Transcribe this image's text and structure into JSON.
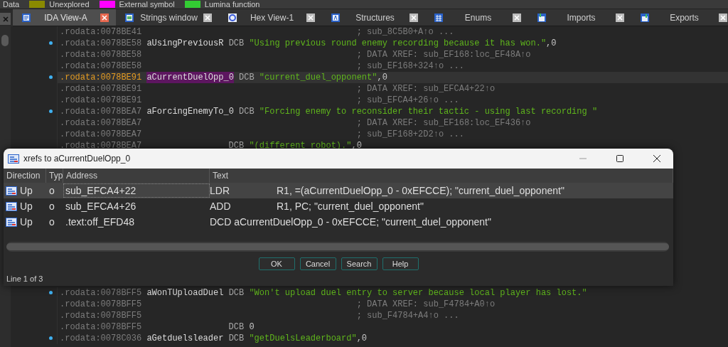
{
  "legend": [
    {
      "label": "Data"
    },
    {
      "label": "Unexplored",
      "color": "#8a8a00"
    },
    {
      "label": "External symbol",
      "color": "#ff00ff"
    },
    {
      "label": "Lumina function",
      "color": "#33cc33"
    }
  ],
  "tabs": [
    {
      "label": "IDA View-A",
      "kind": "disassembly",
      "selected": true
    },
    {
      "label": "Strings window",
      "kind": "strings",
      "selected": false
    },
    {
      "label": "Hex View-1",
      "kind": "hex",
      "selected": false
    },
    {
      "label": "Structures",
      "kind": "structures",
      "selected": false
    },
    {
      "label": "Enums",
      "kind": "enums",
      "selected": false
    },
    {
      "label": "Imports",
      "kind": "imports",
      "selected": false
    },
    {
      "label": "Exports",
      "kind": "exports",
      "selected": false
    }
  ],
  "listing": {
    "lines": [
      {
        "address": ".rodata:0078BE41",
        "comment": "; sub_8C5B0+A↑o ...",
        "marker": false,
        "current": false
      },
      {
        "address": ".rodata:0078BE58",
        "label": "aUsingPreviousR",
        "mnemonic": "DCB",
        "string": "\"Using previous round enemy recording because it has won.\"",
        "tail": ",0",
        "marker": true,
        "current": false
      },
      {
        "address": ".rodata:0078BE58",
        "comment": "; DATA XREF: sub_EF168:loc_EF48A↑o",
        "marker": false,
        "current": false
      },
      {
        "address": ".rodata:0078BE58",
        "comment": "; sub_EF168+324↑o ...",
        "marker": false,
        "current": false
      },
      {
        "address": ".rodata:0078BE91",
        "label": "aCurrentDuelOpp_0",
        "mnemonic": "DCB",
        "string": "\"current_duel_opponent\"",
        "tail": ",0",
        "marker": true,
        "current": true
      },
      {
        "address": ".rodata:0078BE91",
        "comment": "; DATA XREF: sub_EFCA4+22↑o",
        "marker": false,
        "current": false
      },
      {
        "address": ".rodata:0078BE91",
        "comment": "; sub_EFCA4+26↑o ...",
        "marker": false,
        "current": false
      },
      {
        "address": ".rodata:0078BEA7",
        "label": "aForcingEnemyTo_0",
        "mnemonic": "DCB",
        "string": "\"Forcing enemy to reconsider their tactic - using last recording \"",
        "marker": true,
        "current": false
      },
      {
        "address": ".rodata:0078BEA7",
        "comment": "; DATA XREF: sub_EF168:loc_EF436↑o",
        "marker": false,
        "current": false
      },
      {
        "address": ".rodata:0078BEA7",
        "comment": "; sub_EF168+2D2↑o ...",
        "marker": false,
        "current": false
      },
      {
        "address": ".rodata:0078BEA7",
        "mnemonic": "DCB",
        "string": "\"(different robot).\"",
        "tail": ",0",
        "marker": false,
        "current": false
      }
    ],
    "lines_below": [
      {
        "address": ".rodata:0078BFF5",
        "label": "aWonTUploadDuel",
        "mnemonic": "DCB",
        "string": "\"Won't upload duel entry to server because local player has lost.\"",
        "marker": true,
        "current": false
      },
      {
        "address": ".rodata:0078BFF5",
        "comment": "; DATA XREF: sub_F4784+A0↑o",
        "marker": false,
        "current": false
      },
      {
        "address": ".rodata:0078BFF5",
        "comment": "; sub_F4784+A4↑o ...",
        "marker": false,
        "current": false
      },
      {
        "address": ".rodata:0078BFF5",
        "mnemonic": "DCB",
        "tail": "0",
        "marker": false,
        "current": false
      },
      {
        "address": ".rodata:0078C036",
        "label": "aGetduelsleader",
        "mnemonic": "DCB",
        "string": "\"getDuelsLeaderboard\"",
        "tail": ",0",
        "marker": true,
        "current": false
      }
    ]
  },
  "dialog": {
    "title": "xrefs to aCurrentDuelOpp_0",
    "columns": [
      "Direction",
      "Typ",
      "Address",
      "Text"
    ],
    "rows": [
      {
        "direction": "Up",
        "type": "o",
        "address": "sub_EFCA4+22",
        "text": "LDR\tR1, =(aCurrentDuelOpp_0 - 0xEFCCE); \"current_duel_opponent\"",
        "selected": true
      },
      {
        "direction": "Up",
        "type": "o",
        "address": "sub_EFCA4+26",
        "text": "ADD\tR1, PC; \"current_duel_opponent\"",
        "selected": false
      },
      {
        "direction": "Up",
        "type": "o",
        "address": ".text:off_EFD48",
        "text": "DCD aCurrentDuelOpp_0 - 0xEFCCE; \"current_duel_opponent\"",
        "selected": false
      }
    ],
    "buttons": [
      "OK",
      "Cancel",
      "Search",
      "Help"
    ],
    "status": "Line 1 of 3"
  }
}
